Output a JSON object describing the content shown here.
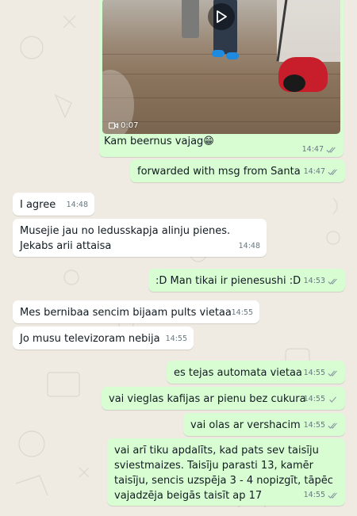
{
  "colors": {
    "wallpaper": "#efeae2",
    "incoming": "#ffffff",
    "outgoing": "#d9fdd3",
    "read_tick": "#53bdeb",
    "meta": "#667781"
  },
  "video_message": {
    "duration": "0:07",
    "caption": "Kam beernus vajag",
    "emoji": "😁",
    "time": "14:47",
    "icon": "video-camera-icon"
  },
  "messages": [
    {
      "dir": "out",
      "text": "forwarded with msg from Santa",
      "time": "14:47",
      "tick": "double"
    },
    {
      "dir": "in",
      "text": "I agree",
      "time": "14:48"
    },
    {
      "dir": "in",
      "text": "Musejie jau no ledusskapja alinju pienes. Jekabs arii attaisa",
      "time": "14:48"
    },
    {
      "dir": "out",
      "text": ":D Man tikai ir pienesushi :D",
      "time": "14:53",
      "tick": "double"
    },
    {
      "dir": "in",
      "text": "Mes bernibaa sencim bijaam pults vietaa",
      "time": "14:55"
    },
    {
      "dir": "in",
      "text": "Jo musu televizoram nebija",
      "time": "14:55"
    },
    {
      "dir": "out",
      "text": "es tejas automata vietaa",
      "time": "14:55",
      "tick": "double"
    },
    {
      "dir": "out",
      "text": "vai vieglas kafijas ar pienu bez cukura",
      "time": "14:55",
      "tick": "single"
    },
    {
      "dir": "out",
      "text": "vai olas ar vershacim",
      "time": "14:55",
      "tick": "double"
    },
    {
      "dir": "out",
      "text": "vai arī tiku apdalīts, kad pats sev taisīju sviestmaizes. Taisīju parasti 13, kamēr taisīju, sencis uzspēja 3 - 4 nopizgīt, tāpēc vajadzēja beigās taisīt ap 17",
      "time": "14:55",
      "tick": "double"
    }
  ]
}
